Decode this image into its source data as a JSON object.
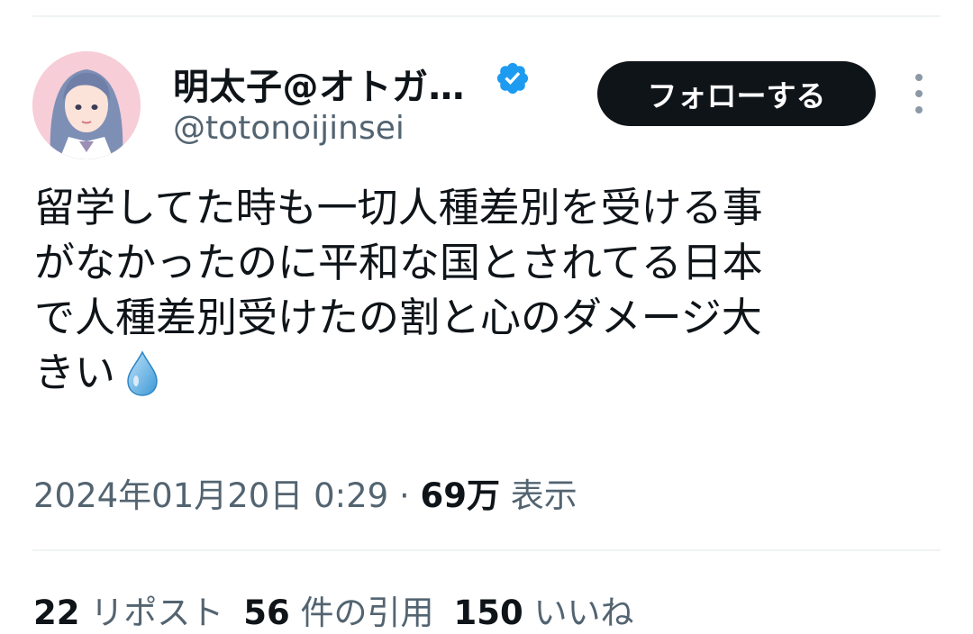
{
  "profile": {
    "display_name": "明太子@オトガ…",
    "handle": "@totonoijinsei"
  },
  "follow_button": {
    "label": "フォローする"
  },
  "tweet": {
    "lines": [
      "留学してた時も一切人種差別を受ける事",
      "がなかったのに平和な国とされてる日本",
      "で人種差別受けたの割と心のダメージ大",
      "きい"
    ],
    "emoji": "droplet-icon"
  },
  "meta": {
    "timestamp": "2024年01月20日 0:29",
    "separator": " · ",
    "views_count": "69万",
    "views_label": " 表示"
  },
  "stats": {
    "reposts_count": "22",
    "reposts_label": " リポスト",
    "quotes_count": "56",
    "quotes_label": " 件の引用",
    "likes_count": "150",
    "likes_label": " いいね"
  },
  "colors": {
    "text": "#0f1419",
    "secondary": "#536471",
    "verified": "#1d9bf0",
    "button_bg": "#0f1419",
    "button_text": "#ffffff",
    "divider": "#eff3f4"
  }
}
